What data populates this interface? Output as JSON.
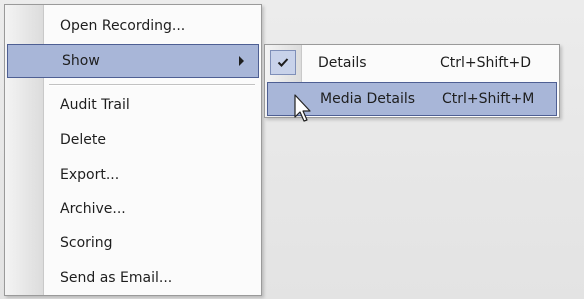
{
  "context_menu": {
    "items": [
      {
        "label": "Open Recording..."
      },
      {
        "label": "Show"
      },
      {
        "label": "Audit Trail"
      },
      {
        "label": "Delete"
      },
      {
        "label": "Export..."
      },
      {
        "label": "Archive..."
      },
      {
        "label": "Scoring"
      },
      {
        "label": "Send as Email..."
      }
    ],
    "highlighted_item": "Show",
    "arrow_icon": "chevron-right-icon"
  },
  "show_submenu": {
    "items": [
      {
        "label": "Details",
        "shortcut": "Ctrl+Shift+D",
        "checked": true
      },
      {
        "label": "Media Details",
        "shortcut": "Ctrl+Shift+M",
        "checked": false
      }
    ],
    "highlighted_item": "Media Details",
    "check_icon": "checkmark-icon"
  },
  "colors": {
    "highlight_fill": "#a8b6d8",
    "highlight_border": "#4e5f93",
    "menu_background": "#fbfbfb"
  }
}
